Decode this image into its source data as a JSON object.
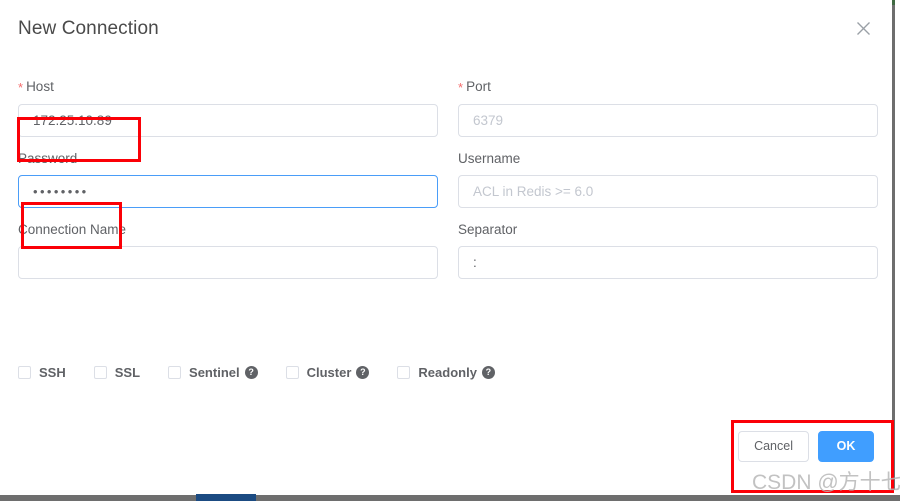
{
  "dialog": {
    "title": "New Connection",
    "close_icon": "close-icon"
  },
  "form": {
    "fields": [
      {
        "label": "Host",
        "required": true,
        "value": "172.25.10.89",
        "placeholder": "",
        "focused": false,
        "name": "host"
      },
      {
        "label": "Port",
        "required": true,
        "value": "",
        "placeholder": "6379",
        "focused": false,
        "name": "port"
      },
      {
        "label": "Password",
        "required": false,
        "value": "••••••••",
        "placeholder": "",
        "focused": true,
        "name": "password"
      },
      {
        "label": "Username",
        "required": false,
        "value": "",
        "placeholder": "ACL in Redis >= 6.0",
        "focused": false,
        "name": "username"
      },
      {
        "label": "Connection Name",
        "required": false,
        "value": "",
        "placeholder": "",
        "focused": false,
        "name": "connection-name"
      },
      {
        "label": "Separator",
        "required": false,
        "value": ":",
        "placeholder": "",
        "focused": false,
        "name": "separator"
      }
    ],
    "required_marker": "*"
  },
  "checkboxes": [
    {
      "label": "SSH",
      "checked": false,
      "help": false,
      "help_glyph": "?"
    },
    {
      "label": "SSL",
      "checked": false,
      "help": false,
      "help_glyph": "?"
    },
    {
      "label": "Sentinel",
      "checked": false,
      "help": true,
      "help_glyph": "?"
    },
    {
      "label": "Cluster",
      "checked": false,
      "help": true,
      "help_glyph": "?"
    },
    {
      "label": "Readonly",
      "checked": false,
      "help": true,
      "help_glyph": "?"
    }
  ],
  "footer": {
    "cancel_label": "Cancel",
    "ok_label": "OK"
  },
  "watermark": {
    "text": "CSDN @方十七"
  },
  "colors": {
    "primary": "#409eff",
    "focus_border": "#4a9df8",
    "required_star": "#f56c6c",
    "annotation": "#fb0007",
    "border": "#dcdfe6",
    "text": "#606266",
    "placeholder": "#c3c7cf"
  }
}
